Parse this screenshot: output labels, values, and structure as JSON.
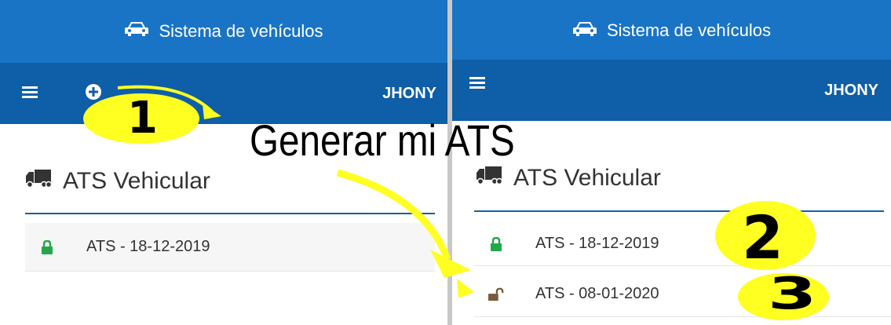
{
  "app": {
    "title": "Sistema de vehículos",
    "user": "JHONY"
  },
  "section": {
    "title": "ATS Vehicular"
  },
  "left_panel": {
    "items": [
      {
        "label": "ATS - 18-12-2019",
        "status": "locked"
      }
    ]
  },
  "right_panel": {
    "items": [
      {
        "label": "ATS - 18-12-2019",
        "status": "locked"
      },
      {
        "label": "ATS - 08-01-2020",
        "status": "unlocked"
      }
    ]
  },
  "annotations": {
    "caption": "Generar mi ATS",
    "step1": "1",
    "step2": "2",
    "step3": "3"
  },
  "colors": {
    "header": "#1a74c6",
    "navbar": "#0e5ea8",
    "accent_rule": "#1a5f9c",
    "lock_green": "#22a84a",
    "lock_brown": "#7a5a3a",
    "highlight_yellow": "#ffff22"
  },
  "icons": {
    "header": "car-icon",
    "menu": "hamburger-menu-icon",
    "add": "plus-circle-icon",
    "section": "truck-icon",
    "locked": "lock-icon",
    "unlocked": "unlock-icon"
  }
}
